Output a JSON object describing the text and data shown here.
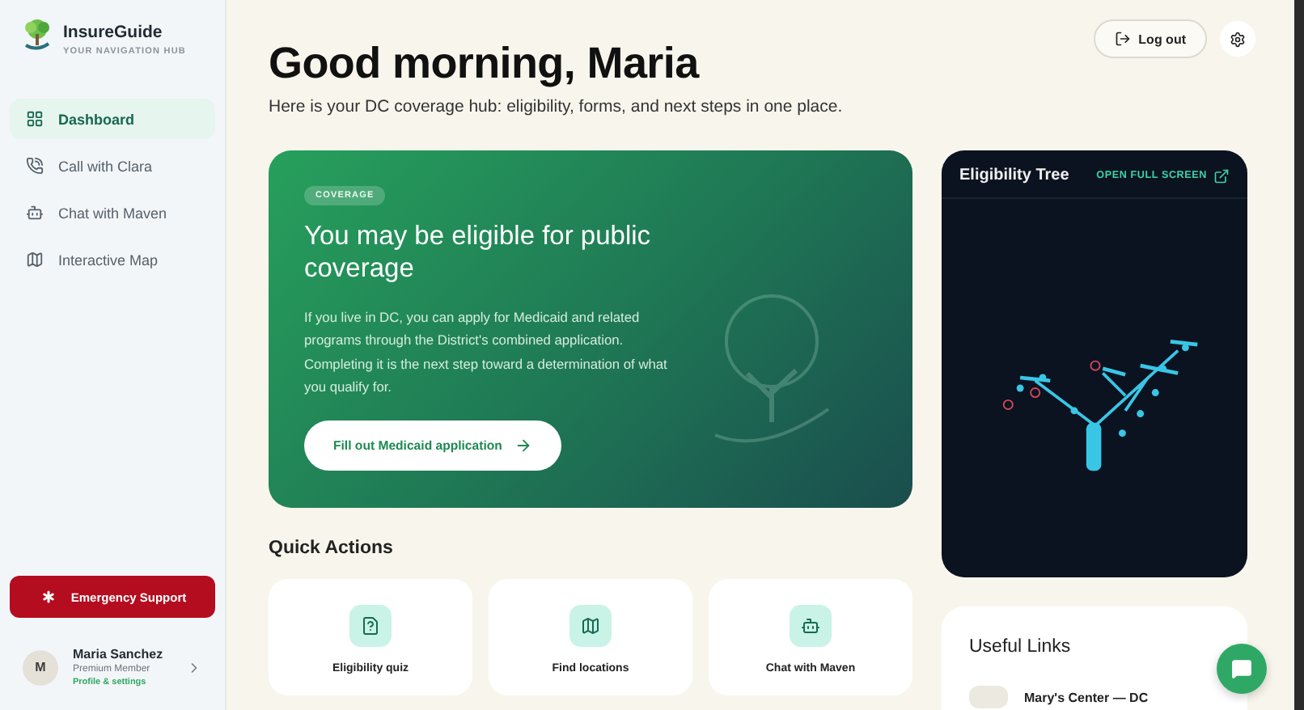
{
  "brand": {
    "name": "InsureGuide",
    "tagline": "YOUR NAVIGATION HUB"
  },
  "nav": [
    {
      "label": "Dashboard",
      "kind": "grid",
      "selected": true
    },
    {
      "label": "Call with Clara",
      "kind": "phone",
      "selected": false
    },
    {
      "label": "Chat with Maven",
      "kind": "bot",
      "selected": false
    },
    {
      "label": "Interactive Map",
      "kind": "map",
      "selected": false
    }
  ],
  "emergency": {
    "label": "Emergency Support"
  },
  "profile": {
    "initial": "M",
    "name": "Maria Sanchez",
    "role": "Premium Member",
    "link": "Profile & settings"
  },
  "header": {
    "greeting": "Good morning, Maria",
    "subtitle": "Here is your DC coverage hub: eligibility, forms, and next steps in one place.",
    "logout": "Log out"
  },
  "hero": {
    "badge": "COVERAGE",
    "title": "You may be eligible for public coverage",
    "body": "If you live in DC, you can apply for Medicaid and related programs through the District's combined application. Completing it is the next step toward a determination of what you qualify for.",
    "button": "Fill out Medicaid application"
  },
  "tree_card": {
    "title": "Eligibility Tree",
    "action": "OPEN FULL SCREEN"
  },
  "quick_actions": {
    "title": "Quick Actions",
    "items": [
      {
        "label": "Eligibility quiz",
        "kind": "quiz"
      },
      {
        "label": "Find locations",
        "kind": "map"
      },
      {
        "label": "Chat with Maven",
        "kind": "bot"
      }
    ]
  },
  "useful_links": {
    "title": "Useful Links",
    "items": [
      {
        "name": "Mary's Center — DC"
      }
    ]
  }
}
